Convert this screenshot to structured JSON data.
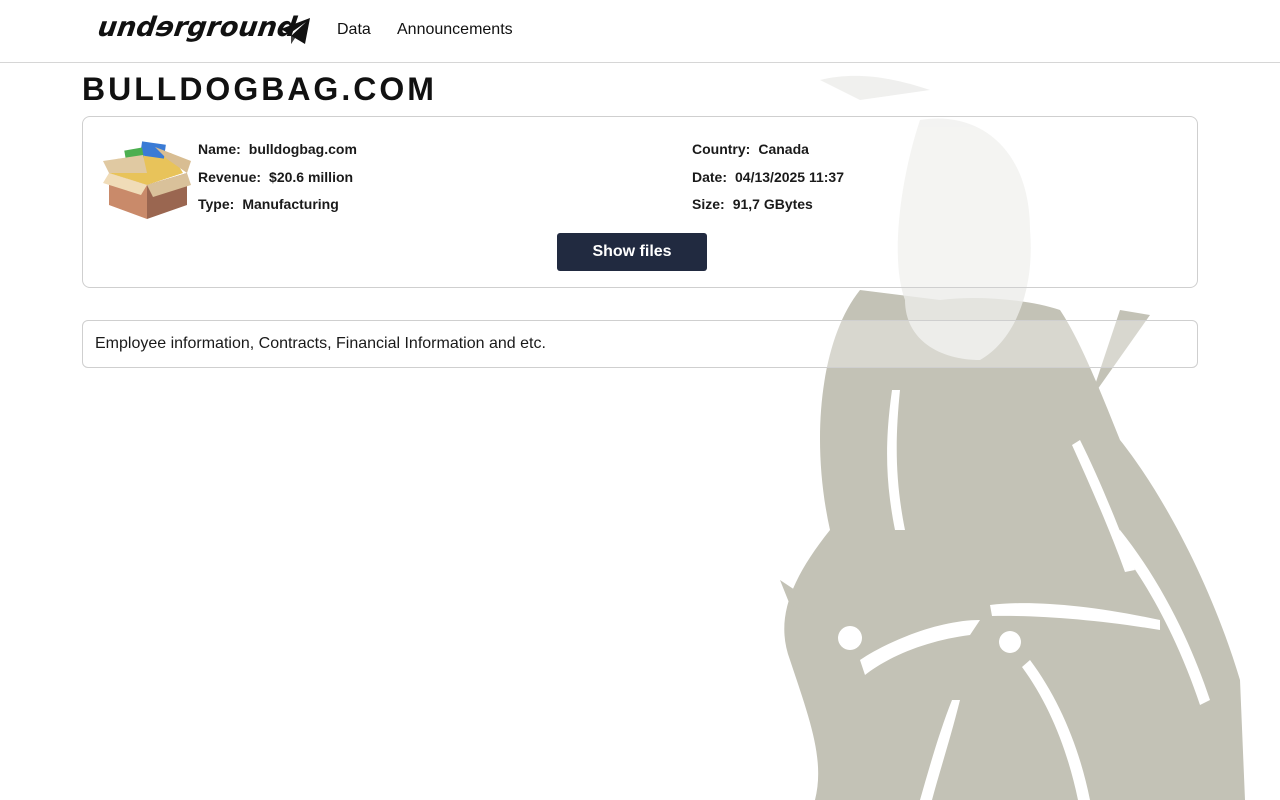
{
  "header": {
    "logo_text": "undɘrground",
    "nav": [
      {
        "label": "Data"
      },
      {
        "label": "Announcements"
      }
    ],
    "telegram_icon": "telegram-icon"
  },
  "page": {
    "title": "BULLDOGBAG.COM"
  },
  "card": {
    "icon": "package-box-icon",
    "fields": {
      "name": {
        "label": "Name:",
        "value": "bulldogbag.com"
      },
      "revenue": {
        "label": "Revenue:",
        "value": "$20.6 million"
      },
      "type": {
        "label": "Type:",
        "value": "Manufacturing"
      },
      "country": {
        "label": "Country:",
        "value": "Canada"
      },
      "date": {
        "label": "Date:",
        "value": "04/13/2025 11:37"
      },
      "size": {
        "label": "Size:",
        "value": "91,7 GBytes"
      }
    },
    "button_label": "Show files"
  },
  "description": {
    "text": "Employee information, Contracts, Financial Information and etc."
  },
  "colors": {
    "button_bg": "#212a40",
    "background_figure": "#c3c2b6"
  }
}
